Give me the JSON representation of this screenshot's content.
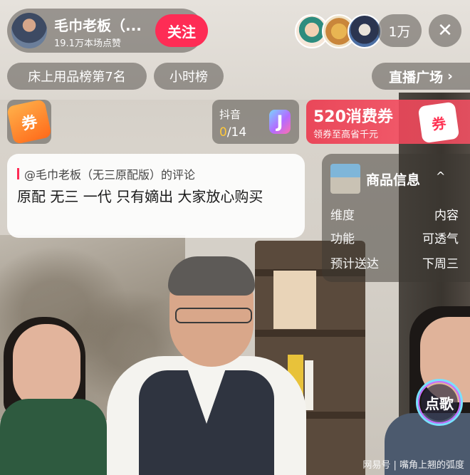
{
  "host": {
    "name": "毛巾老板（...",
    "likes": "19.1万本场点赞",
    "follow_label": "关注"
  },
  "viewers": {
    "count": "1万"
  },
  "close_label": "✕",
  "ranks": {
    "category_rank": "床上用品榜第7名",
    "hourly_rank": "小时榜",
    "plaza_label": "直播广场",
    "plaza_chevron": "›"
  },
  "coupon_left": {
    "label": "券"
  },
  "douyin_task": {
    "title": "抖音",
    "progress_current": "0",
    "progress_total": "/14",
    "logo": "J"
  },
  "promo": {
    "title": "520消费券",
    "subtitle": "领券至高省千元",
    "ticket": "券"
  },
  "comment": {
    "who": "@毛巾老板（无三原配版）的评论",
    "text": "原配 无三 一代 只有嫡出 大家放心购买"
  },
  "product_info": {
    "title": "商品信息",
    "chevron": "^",
    "rows": [
      {
        "k": "维度",
        "v": "内容"
      },
      {
        "k": "功能",
        "v": "可透气"
      },
      {
        "k": "预计送达",
        "v": "下周三"
      }
    ]
  },
  "song_label": "点歌",
  "watermark": "网易号 | 嘴角上翘的弧度",
  "colors": {
    "accent": "#fe2c55",
    "highlight": "#ffc93a",
    "promo": "#eb3c50"
  }
}
